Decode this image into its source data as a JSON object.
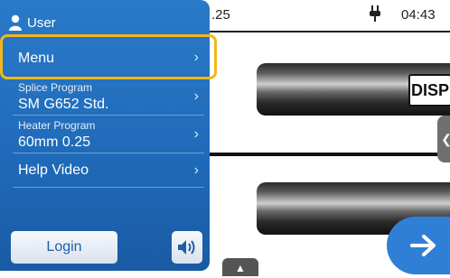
{
  "status_bar": {
    "program_fragment": ".25",
    "power_icon": "plug-icon",
    "time": "04:43"
  },
  "screen": {
    "disp_label": "DISP",
    "next_icon": "arrow-right-icon"
  },
  "menu_panel": {
    "user_label": "User",
    "user_icon": "user-icon",
    "items": [
      {
        "label": "Menu"
      },
      {
        "caption": "Splice Program",
        "value": "SM G652 Std."
      },
      {
        "caption": "Heater Program",
        "value": "60mm 0.25"
      },
      {
        "label": "Help Video"
      }
    ],
    "login_label": "Login",
    "sound_icon": "speaker-icon"
  },
  "colors": {
    "panel_blue": "#2a7ac9",
    "highlight": "#f2b818",
    "next_button": "#2f7fd6"
  }
}
